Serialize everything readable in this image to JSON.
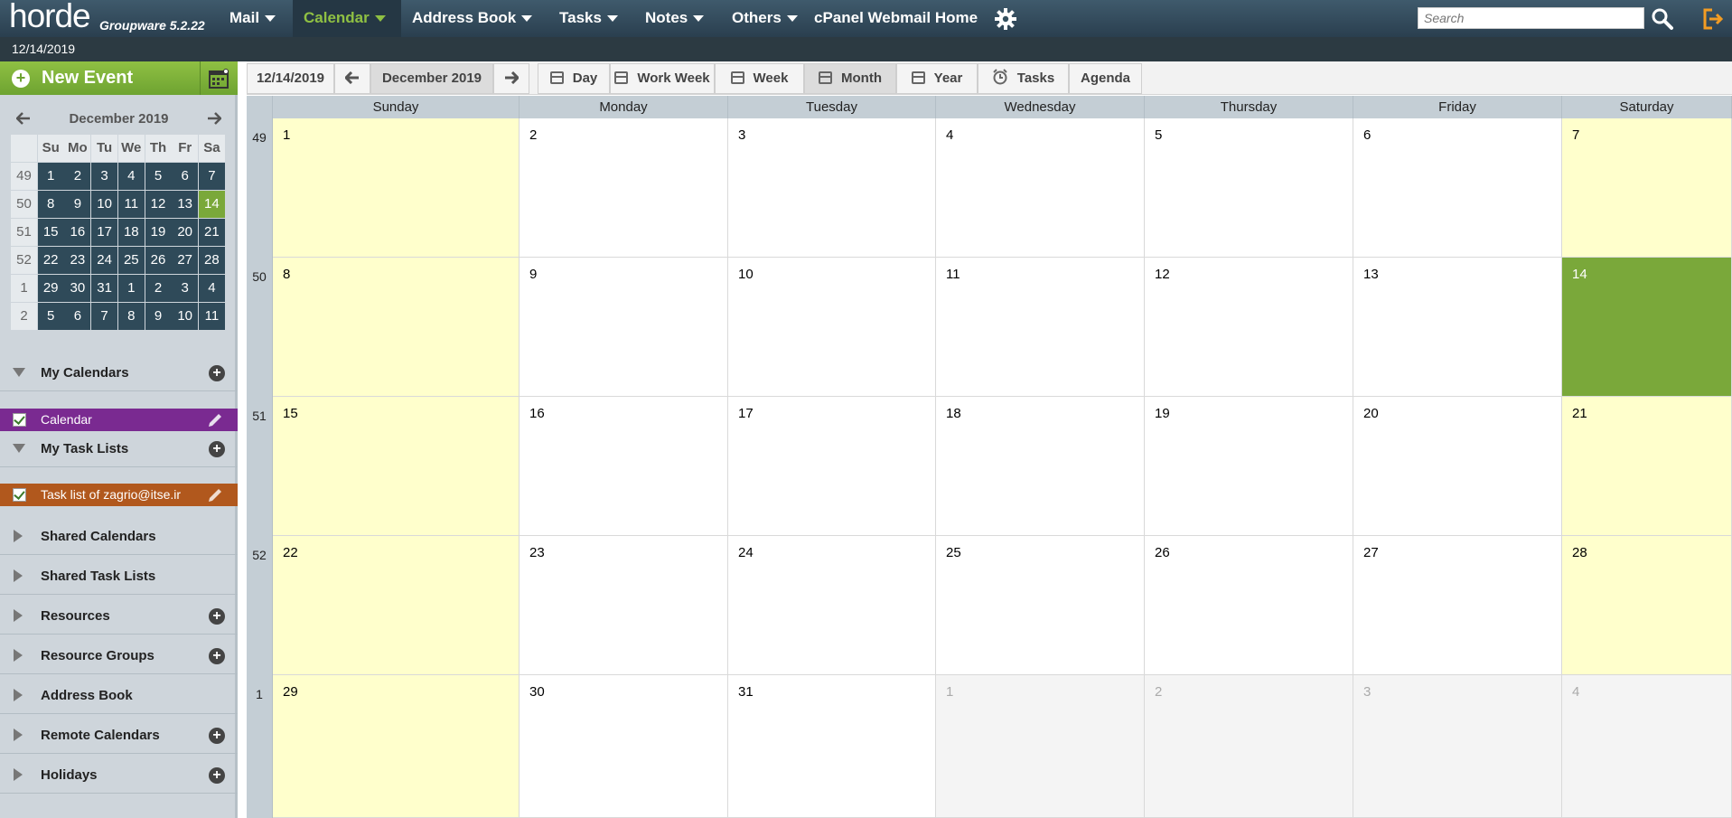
{
  "topbar": {
    "logo": "horde",
    "logo_subtitle": "Groupware 5.2.22",
    "menu": [
      {
        "label": "Mail",
        "has_caret": true,
        "active": false
      },
      {
        "label": "Calendar",
        "has_caret": true,
        "active": true
      },
      {
        "label": "Address Book",
        "has_caret": true,
        "active": false
      },
      {
        "label": "Tasks",
        "has_caret": true,
        "active": false
      },
      {
        "label": "Notes",
        "has_caret": true,
        "active": false
      },
      {
        "label": "Others",
        "has_caret": true,
        "active": false
      },
      {
        "label": "cPanel Webmail Home",
        "has_caret": false,
        "active": false
      }
    ],
    "search_placeholder": "Search",
    "icons": [
      "gear-icon",
      "search-icon",
      "logout-icon"
    ]
  },
  "datebar": {
    "date": "12/14/2019"
  },
  "sidebar": {
    "new_event_label": "New Event",
    "minical": {
      "title": "December 2019",
      "day_headers": [
        "Su",
        "Mo",
        "Tu",
        "We",
        "Th",
        "Fr",
        "Sa"
      ],
      "weeks": [
        {
          "week": "49",
          "days": [
            "1",
            "2",
            "3",
            "4",
            "5",
            "6",
            "7"
          ]
        },
        {
          "week": "50",
          "days": [
            "8",
            "9",
            "10",
            "11",
            "12",
            "13",
            "14"
          ]
        },
        {
          "week": "51",
          "days": [
            "15",
            "16",
            "17",
            "18",
            "19",
            "20",
            "21"
          ]
        },
        {
          "week": "52",
          "days": [
            "22",
            "23",
            "24",
            "25",
            "26",
            "27",
            "28"
          ]
        },
        {
          "week": "1",
          "days": [
            "29",
            "30",
            "31",
            "1",
            "2",
            "3",
            "4"
          ]
        },
        {
          "week": "2",
          "days": [
            "5",
            "6",
            "7",
            "8",
            "9",
            "10",
            "11"
          ]
        }
      ],
      "today": "14"
    },
    "sections": {
      "my_calendars": "My Calendars",
      "calendar_item": "Calendar",
      "my_task_lists": "My Task Lists",
      "task_item": "Task list of zagrio@itse.ir",
      "shared_calendars": "Shared Calendars",
      "shared_task_lists": "Shared Task Lists",
      "resources": "Resources",
      "resource_groups": "Resource Groups",
      "address_book": "Address Book",
      "remote_calendars": "Remote Calendars",
      "holidays": "Holidays"
    },
    "colors": {
      "calendar": "#7a2a91",
      "tasklist": "#b1581d"
    }
  },
  "toolbar": {
    "date": "12/14/2019",
    "period": "December 2019",
    "views": [
      "Day",
      "Work Week",
      "Week",
      "Month",
      "Year",
      "Tasks",
      "Agenda"
    ],
    "selected_view": "Month"
  },
  "month": {
    "day_headers": [
      "Sunday",
      "Monday",
      "Tuesday",
      "Wednesday",
      "Thursday",
      "Friday",
      "Saturday"
    ],
    "weeks": [
      {
        "week": "49",
        "days": [
          "1",
          "2",
          "3",
          "4",
          "5",
          "6",
          "7"
        ]
      },
      {
        "week": "50",
        "days": [
          "8",
          "9",
          "10",
          "11",
          "12",
          "13",
          "14"
        ]
      },
      {
        "week": "51",
        "days": [
          "15",
          "16",
          "17",
          "18",
          "19",
          "20",
          "21"
        ]
      },
      {
        "week": "52",
        "days": [
          "22",
          "23",
          "24",
          "25",
          "26",
          "27",
          "28"
        ]
      },
      {
        "week": "1",
        "days": [
          "29",
          "30",
          "31",
          "1",
          "2",
          "3",
          "4"
        ]
      }
    ],
    "today": "14",
    "colors": {
      "weekend": "#ffffcc",
      "today": "#7aa83a",
      "other_month": "#f4f4f4"
    }
  }
}
